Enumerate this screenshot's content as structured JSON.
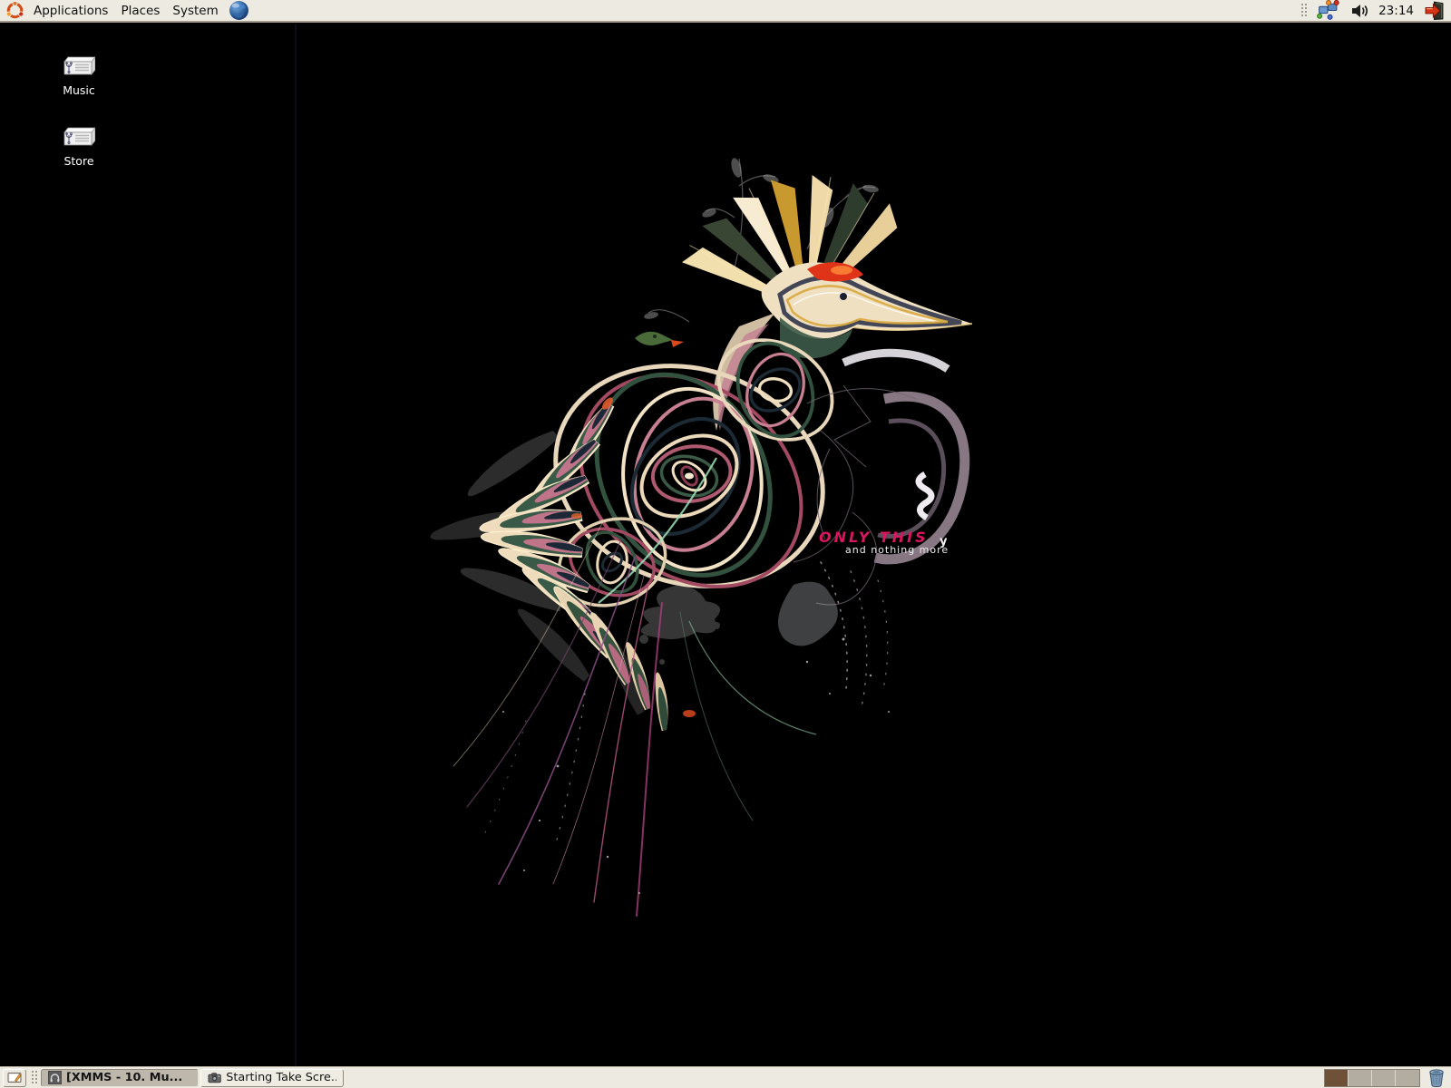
{
  "top_panel": {
    "menus": [
      {
        "label": "Applications"
      },
      {
        "label": "Places"
      },
      {
        "label": "System"
      }
    ],
    "launcher": {
      "name": "web-browser"
    },
    "tray": {
      "clock": "23:14"
    }
  },
  "desktop": {
    "icons": [
      {
        "label": "Music"
      },
      {
        "label": "Store"
      }
    ],
    "wallpaper_text": {
      "line1": "ONLY THIS",
      "line2": "and nothing more",
      "mark": "y"
    }
  },
  "taskbar": {
    "windows": [
      {
        "label": "[XMMS - 10. Mu...",
        "active": true
      },
      {
        "label": "Starting Take Scre...",
        "active": false
      }
    ],
    "workspace_count": "4",
    "active_workspace": "1"
  },
  "icons": {
    "top_panel": [
      "ubuntu-logo-icon",
      "web-browser-globe-icon",
      "panel-grip",
      "network-monitor-icon",
      "volume-icon",
      "logout-icon"
    ],
    "taskbar": [
      "show-desktop-icon",
      "xmms-icon",
      "screenshot-camera-icon",
      "workspace-switcher",
      "trash-icon"
    ],
    "desktop": [
      "usb-drive-icon"
    ]
  },
  "colors": {
    "panel_bg": "#edeae1",
    "panel_border": "#a29b8d",
    "wallpaper_bg": "#000000",
    "accent_text": "#dc1560",
    "active_task_bg": "#bdb7ac",
    "workspace_active": "#6f5138",
    "workspace_inactive": "#b3aca0"
  }
}
